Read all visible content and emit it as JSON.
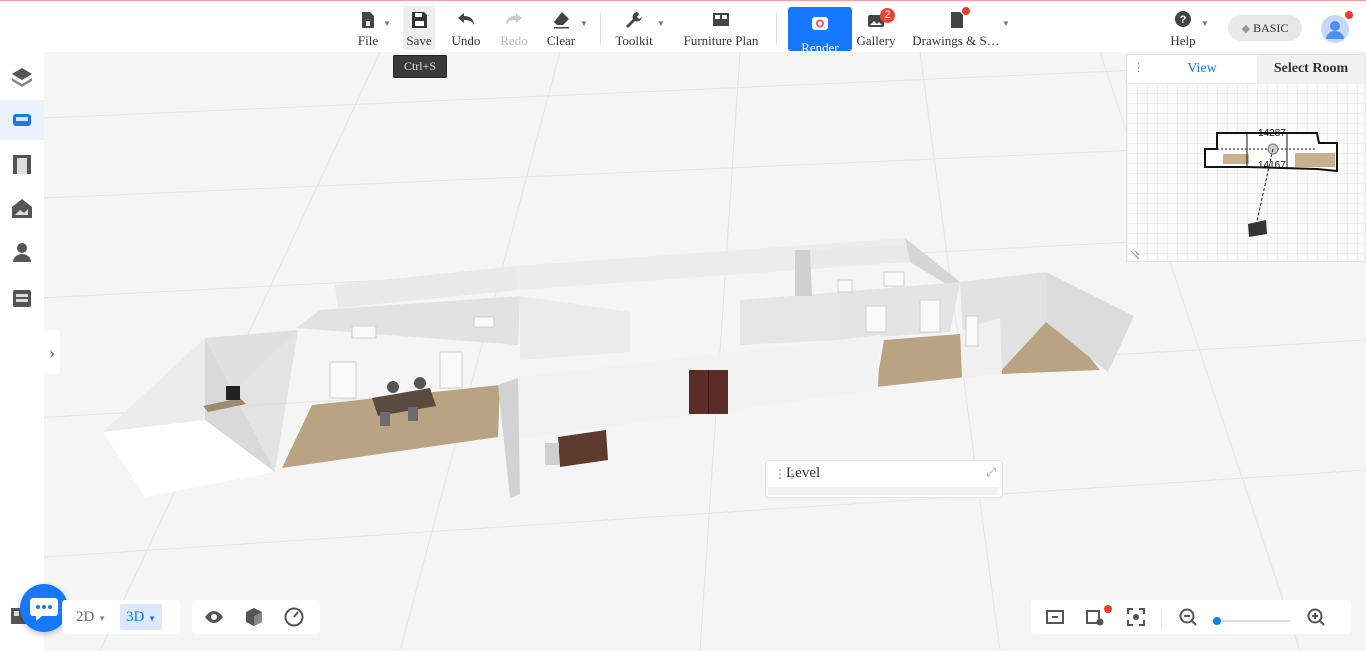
{
  "toolbar": {
    "file": "File",
    "save": "Save",
    "save_tooltip": "Ctrl+S",
    "undo": "Undo",
    "redo": "Redo",
    "clear": "Clear",
    "toolkit": "Toolkit",
    "furniture_plan": "Furniture Plan",
    "render": "Render",
    "gallery": "Gallery",
    "gallery_badge": "2",
    "drawings": "Drawings & S…",
    "help": "Help",
    "plan": "BASIC"
  },
  "sidebar": {
    "items": [
      {
        "icon": "cube-layers-icon"
      },
      {
        "icon": "sofa-icon",
        "active": true
      },
      {
        "icon": "door-icon"
      },
      {
        "icon": "house-roof-icon"
      },
      {
        "icon": "person-icon"
      },
      {
        "icon": "cabinet-icon"
      }
    ]
  },
  "minimap": {
    "tab_view": "View",
    "tab_room": "Select Room",
    "dim_top": "14287",
    "dim_mid": "14167"
  },
  "level_panel": {
    "title": "Level"
  },
  "view_mode": {
    "mode_2d": "2D",
    "mode_3d": "3D",
    "active": "3D"
  },
  "colors": {
    "accent": "#1677ff",
    "badge": "#f04134",
    "floor": "#b09a7a",
    "wall": "#e6e6e6"
  },
  "zoom": {
    "level": 0.02
  }
}
